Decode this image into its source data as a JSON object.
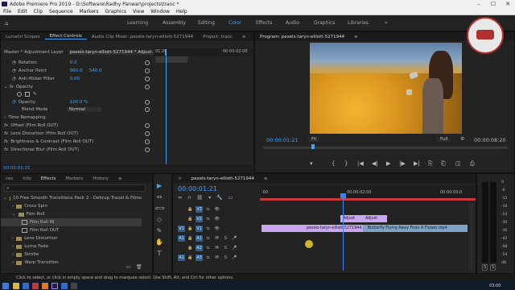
{
  "window": {
    "title": "Adobe Premiere Pro 2019 - D:\\Software\\Radhy Panwar\\projects\\tranc *",
    "min": "–",
    "max": "☐",
    "close": "✕"
  },
  "menu": [
    "File",
    "Edit",
    "Clip",
    "Sequence",
    "Markers",
    "Graphics",
    "View",
    "Window",
    "Help"
  ],
  "workspaces": [
    "Learning",
    "Assembly",
    "Editing",
    "Color",
    "Effects",
    "Audio",
    "Graphics",
    "Libraries"
  ],
  "workspace_more": "»",
  "left_panel": {
    "tabs": [
      "Lumetri Scopes",
      "Effect Controls",
      "Audio Clip Mixer: pexels-taryn-elliott-5271944",
      "Project: tranc"
    ],
    "menu_icon": "≡",
    "source": "Master * Adjustment Layer",
    "clip": "pexels-taryn-elliott-5271944 * Adjust...",
    "ruler_time": "01:20",
    "ruler_end": "00:00:02:00",
    "rotation_label": "Rotation",
    "rotation_value": "0.0",
    "anchor_label": "Anchor Point",
    "anchor_x": "960.0",
    "anchor_y": "540.0",
    "antiflicker_label": "Anti-flicker Filter",
    "antiflicker_value": "0.00",
    "opacity_header": "Opacity",
    "opacity_label": "Opacity",
    "opacity_value": "100.0 %",
    "blend_label": "Blend Mode",
    "blend_value": "Normal",
    "effects": [
      "Time Remapping",
      "Offset (Film Roll OUT)",
      "Lens Distortion (Film Roll OUT)",
      "Brightness & Contrast (Film Roll OUT)",
      "Directional Blur (Film Roll OUT)"
    ],
    "timecode": "00:00:01:21"
  },
  "program": {
    "tab": "Program: pexels-taryn-elliott-5271944",
    "menu_icon": "≡",
    "timecode": "00:00:01:21",
    "fit": "Fit",
    "quality": "Full",
    "duration": "00:00:08:20"
  },
  "transport": [
    "▾",
    "{",
    "}",
    "|◀",
    "◀|",
    "▶",
    "|▶",
    "▶|",
    "⎘",
    "⎗",
    "◫",
    "⎙"
  ],
  "project_panel": {
    "tabs": [
      "ces",
      "Info",
      "Effects",
      "Markers",
      "History"
    ],
    "menu_icon": "≡",
    "items": [
      {
        "label": "10 Free Smooth Transitions Pack 2 - Debrup Travel & Films",
        "selected": false
      },
      {
        "label": "Cross Spin",
        "selected": false
      },
      {
        "label": "Film Roll",
        "selected": false
      },
      {
        "label": "Film Roll IN",
        "selected": true
      },
      {
        "label": "Film Roll OUT",
        "selected": false
      },
      {
        "label": "Lens Distortion",
        "selected": false
      },
      {
        "label": "Luma Fade",
        "selected": false
      },
      {
        "label": "Strobe",
        "selected": false
      },
      {
        "label": "Warp Transition",
        "selected": false
      }
    ]
  },
  "tools": [
    "▶",
    "⇔",
    "⟺",
    "◇",
    "✎",
    "✋",
    "T"
  ],
  "timeline": {
    "tab": "pexels-taryn-elliott-5271944",
    "close_icon": "×",
    "menu_icon": "≡",
    "timecode": "00:00:01:21",
    "ruler": [
      ":00",
      "00:00:02:00",
      "00:00:03:0"
    ],
    "video_tracks": [
      "V3",
      "V2",
      "V1"
    ],
    "audio_tracks": [
      "A1",
      "A2",
      "A3"
    ],
    "source_patch": [
      "V1",
      "A1",
      "A1"
    ],
    "track_buttons": {
      "lock": "🔒",
      "sync": "⇆",
      "eye": "👁",
      "mute": "M",
      "solo": "S",
      "mic": "🎤"
    },
    "clips": {
      "adjust_a": "Adjust",
      "adjust_b": "Adjust",
      "v1_a": "pexels-taryn-elliott-5271944.mp4",
      "v1_b": "Butterfly Flying Away From A Flower.mp4"
    }
  },
  "meter": {
    "labels": [
      "0",
      "-6",
      "-12",
      "-18",
      "-24",
      "-30",
      "-36",
      "-42",
      "-48",
      "-54",
      "dB"
    ],
    "solo": "S",
    "solo2": "S"
  },
  "status": "Click to select, or click in empty space and drag to marquee select. Use Shift, Alt, and Ctrl for other options.",
  "taskbar": {
    "time": "03:00"
  },
  "colors": {
    "accent": "#4a9ff5",
    "playhead": "#3b82f6",
    "video_clip": "#c9a7ee",
    "audio_clip": "#7ea3c7",
    "work_area": "#c53a3a"
  }
}
